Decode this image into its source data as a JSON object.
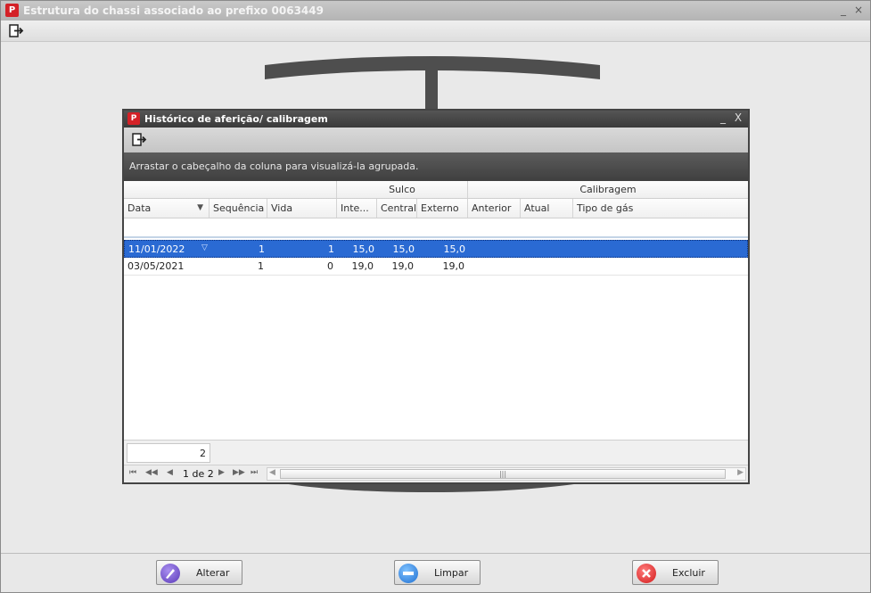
{
  "outer_window": {
    "title": "Estrutura do chassi associado ao prefixo 0063449",
    "icon": "app-logo-icon",
    "minimize_symbol": "_",
    "close_symbol": "×"
  },
  "outer_toolbar": {
    "exit_icon": "exit-icon"
  },
  "dialog": {
    "title": "Histórico de aferição/ calibragem",
    "minimize_symbol": "_",
    "close_symbol": "X",
    "group_panel_text": "Arrastar o cabeçalho da coluna para visualizá-la agrupada.",
    "bands": [
      "Sulco",
      "Calibragem"
    ],
    "columns": [
      "Data",
      "Sequência",
      "Vida",
      "Inte...",
      "Central",
      "Externo",
      "Anterior",
      "Atual",
      "Tipo de gás"
    ],
    "rows": [
      {
        "data": "11/01/2022",
        "sequencia": "1",
        "vida": "1",
        "interno": "15,0",
        "central": "15,0",
        "externo": "15,0",
        "anterior": "",
        "atual": "",
        "tipo_gas": "",
        "selected": true
      },
      {
        "data": "03/05/2021",
        "sequencia": "1",
        "vida": "0",
        "interno": "19,0",
        "central": "19,0",
        "externo": "19,0",
        "anterior": "",
        "atual": "",
        "tipo_gas": "",
        "selected": false
      }
    ],
    "footer_count": "2",
    "pager": {
      "first": "⏮",
      "prev_page": "◀◀",
      "prev": "◀",
      "label": "1 de 2",
      "next": "▶",
      "next_page": "▶▶",
      "last": "⏭"
    },
    "scroll_left": "◀",
    "scroll_right": "▶",
    "scroll_grip": "|||"
  },
  "bottom_buttons": {
    "alterar": "Alterar",
    "limpar": "Limpar",
    "excluir": "Excluir"
  },
  "colors": {
    "selection": "#2a6ad3",
    "brand_red": "#d42127",
    "dialog_title": "#444444"
  }
}
